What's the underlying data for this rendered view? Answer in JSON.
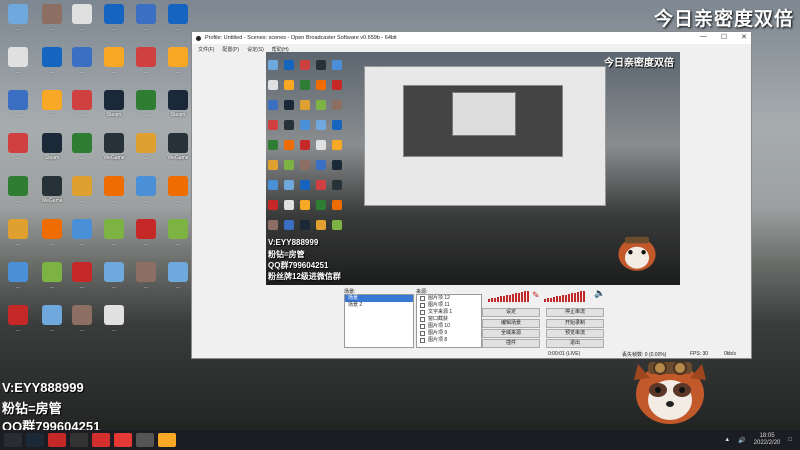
{
  "overlay": {
    "title": "今日亲密度双倍",
    "line1": "V:EYY888999",
    "line2": "粉钻=房管",
    "line3": "QQ群799604251",
    "line4": "粉丝牌12级进微信群"
  },
  "desktop_icons": [
    {
      "label": "...",
      "color": "#6fa8dc"
    },
    {
      "label": "...",
      "color": "#e0e0e0"
    },
    {
      "label": "...",
      "color": "#3a6fc4"
    },
    {
      "label": "...",
      "color": "#d04040"
    },
    {
      "label": "...",
      "color": "#2e7d32"
    },
    {
      "label": "...",
      "color": "#e0a030"
    },
    {
      "label": "...",
      "color": "#4a90d9"
    },
    {
      "label": "...",
      "color": "#c62828"
    },
    {
      "label": "...",
      "color": "#8d6e63"
    },
    {
      "label": "...",
      "color": "#1565c0"
    },
    {
      "label": "...",
      "color": "#f9a825"
    },
    {
      "label": "Steam",
      "color": "#1b2838"
    },
    {
      "label": "WeGame",
      "color": "#263238"
    },
    {
      "label": "...",
      "color": "#ef6c00"
    },
    {
      "label": "...",
      "color": "#7cb342"
    }
  ],
  "obs": {
    "title": "Profile: Untitled - Scenes: scenes - Open Broadcaster Software v0.659b - 64bit",
    "menu": [
      "文件(F)",
      "配置(P)",
      "设定(S)",
      "帮助(H)"
    ],
    "scenes_header": "场景:",
    "sources_header": "来源:",
    "scenes": [
      "场景",
      "场景 2"
    ],
    "sources": [
      "图片项 12",
      "图片项 11",
      "文字来源 1",
      "窗口截获",
      "图片项 10",
      "图片项 9",
      "图片项 8",
      "图片项 7"
    ],
    "buttons": {
      "settings": "设定",
      "stop_stream": "停止串流",
      "edit_scene": "编辑场景",
      "start_record": "开始录制",
      "global_sources": "全域来源",
      "preview": "预览串流",
      "plugins": "插件",
      "exit": "退出"
    },
    "status": {
      "time": "0:00:01 (LIVE)",
      "dropped": "丢失帧数: 0 (0.00%)",
      "fps": "FPS: 30",
      "bitrate": "0kb/s"
    }
  },
  "taskbar": {
    "clock_time": "18:05",
    "clock_date": "2022/2/20"
  }
}
